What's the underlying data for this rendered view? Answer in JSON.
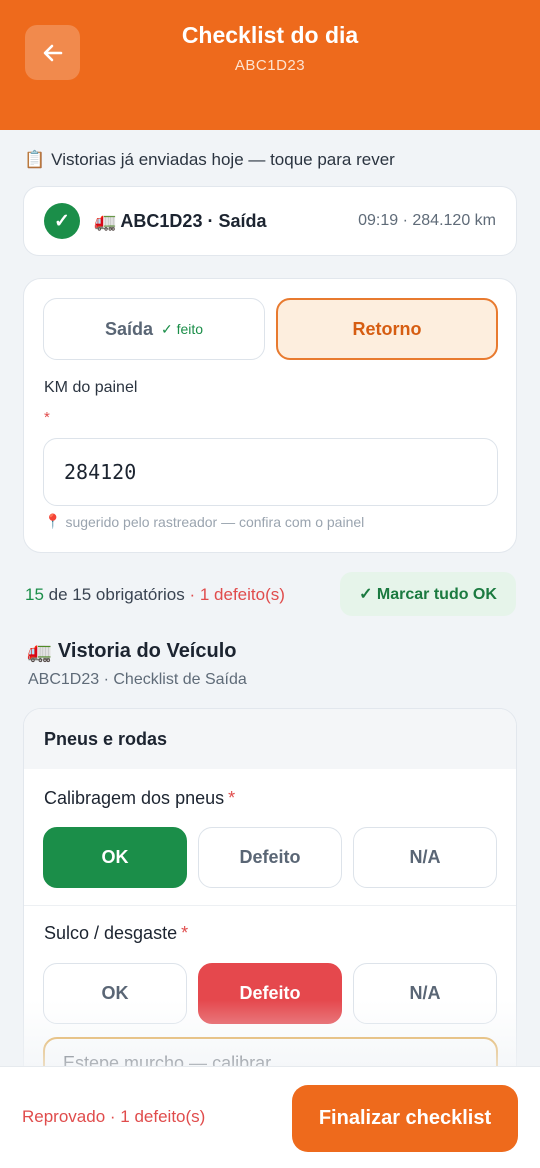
{
  "header": {
    "title": "Checklist do dia",
    "subtitle": "ABC1D23"
  },
  "sent_section": {
    "icon": "clipboard-icon",
    "label": "Vistorias já enviadas hoje — toque para rever",
    "items": [
      {
        "icon": "truck-icon",
        "title": "ABC1D23 · Saída",
        "meta": "09:19 · 284.120 km",
        "status": "done"
      }
    ]
  },
  "km": {
    "segments": {
      "saida_label": "Saída",
      "saida_done": "✓ feito",
      "retorno_label": "Retorno",
      "selected": "Retorno"
    },
    "label": "KM do painel",
    "required_mark": "*",
    "value": "284120",
    "hint": "sugerido pelo rastreador — confira com o painel",
    "hint_icon": "pin-icon"
  },
  "progress": {
    "done_count": "15",
    "total_text": " de 15 obrigatórios",
    "defects_text": " · 1 defeito(s)",
    "mark_all_label": "✓ Marcar tudo OK"
  },
  "inspection": {
    "icon": "truck-icon",
    "title": "Vistoria do Veículo",
    "subtitle": "ABC1D23 · Checklist de Saída",
    "groups": [
      {
        "title": "Pneus e rodas",
        "items": [
          {
            "label": "Calibragem dos pneus",
            "required": "*",
            "options": [
              "OK",
              "Defeito",
              "N/A"
            ],
            "selected": "OK"
          },
          {
            "label": "Sulco / desgaste",
            "required": "*",
            "options": [
              "OK",
              "Defeito",
              "N/A"
            ],
            "selected": "Defeito",
            "note": "Estepe murcho — calibrar"
          }
        ]
      }
    ]
  },
  "footer": {
    "status": "Reprovado · 1 defeito(s)",
    "finish_label": "Finalizar checklist"
  },
  "colors": {
    "brand": "#ee6a1c",
    "ok": "#1b8e49",
    "defect": "#e5484d",
    "note_border": "#e0a13a"
  }
}
